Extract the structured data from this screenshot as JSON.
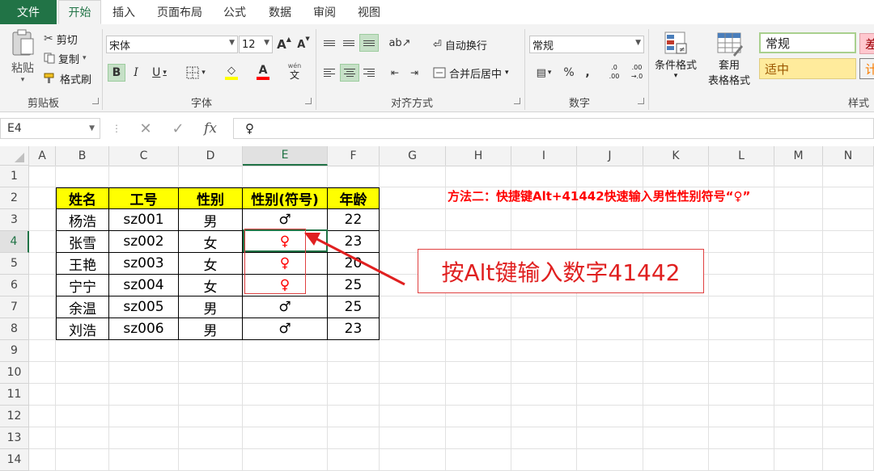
{
  "ribbon_tabs": {
    "file": "文件",
    "items": [
      "开始",
      "插入",
      "页面布局",
      "公式",
      "数据",
      "审阅",
      "视图"
    ]
  },
  "clipboard": {
    "paste": "粘贴",
    "cut": "剪切",
    "copy": "复制",
    "format_painter": "格式刷",
    "label": "剪贴板"
  },
  "font": {
    "name": "宋体",
    "size": "12",
    "grow": "A",
    "shrink": "A",
    "bold": "B",
    "italic": "I",
    "underline": "U",
    "color_letter": "A",
    "phonetic_top": "wén",
    "phonetic_char": "文",
    "label": "字体"
  },
  "alignment": {
    "wrap_text": "自动换行",
    "merge_center": "合并后居中",
    "label": "对齐方式"
  },
  "number": {
    "format": "常规",
    "percent": "%",
    "comma": ",",
    "inc_decimal_top": ".0",
    "inc_decimal_bottom": ".00",
    "dec_decimal_top": ".00",
    "dec_decimal_bottom": "→.0",
    "label": "数字"
  },
  "styles": {
    "conditional_format_line1": "条件格式",
    "format_as_table_line1": "套用",
    "format_as_table_line2": "表格格式",
    "normal": "常规",
    "bad": "差",
    "neutral": "适中",
    "calc": "计",
    "label": "样式"
  },
  "formula_bar": {
    "name_box": "E4",
    "cancel": "✕",
    "enter": "✓",
    "fx": "fx",
    "content": "♀"
  },
  "columns": [
    "A",
    "B",
    "C",
    "D",
    "E",
    "F",
    "G",
    "H",
    "I",
    "J",
    "K",
    "L",
    "M",
    "N"
  ],
  "rows": [
    "1",
    "2",
    "3",
    "4",
    "5",
    "6",
    "7",
    "8",
    "9",
    "10",
    "11",
    "12",
    "13",
    "14"
  ],
  "active_cell": "E4",
  "table": {
    "headers": [
      "姓名",
      "工号",
      "性别",
      "性别(符号)",
      "年龄"
    ],
    "rows": [
      [
        "杨浩",
        "sz001",
        "男",
        "♂",
        "22"
      ],
      [
        "张雪",
        "sz002",
        "女",
        "♀",
        "23"
      ],
      [
        "王艳",
        "sz003",
        "女",
        "♀",
        "20"
      ],
      [
        "宁宁",
        "sz004",
        "女",
        "♀",
        "25"
      ],
      [
        "余温",
        "sz005",
        "男",
        "♂",
        "25"
      ],
      [
        "刘浩",
        "sz006",
        "男",
        "♂",
        "23"
      ]
    ]
  },
  "annotation_title": "方法二：快捷键Alt+41442快速输入男性性别符号“♀”",
  "callout": "按Alt键输入数字41442",
  "colors": {
    "accent": "#217346",
    "header_fill": "#ffff00",
    "annotation_red": "#ff0000",
    "callout_border": "#e04040",
    "female_symbol": "#ff0000"
  }
}
